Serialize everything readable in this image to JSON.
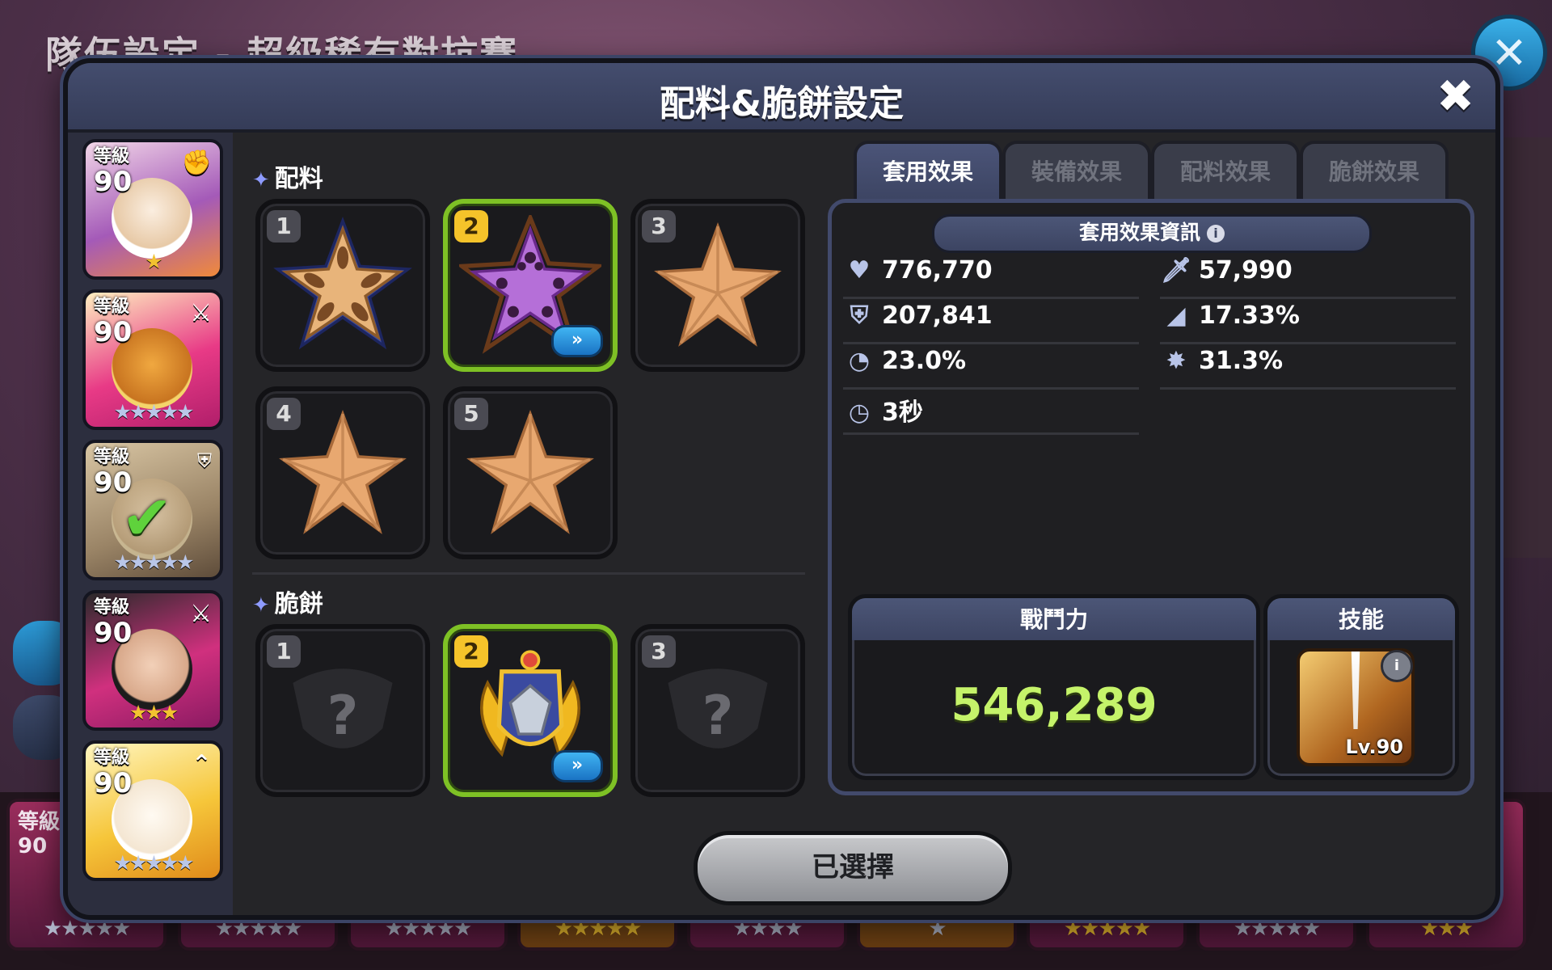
{
  "background": {
    "title": "隊伍設定 - 超級稀有對抗賽",
    "level_label": "等級",
    "level_value": "90"
  },
  "dialog": {
    "title": "配料&脆餅設定",
    "close_label": "✖"
  },
  "roster": [
    {
      "level_label": "等級",
      "level": "90",
      "stars": "★",
      "star_color": "#f2c230",
      "class_icon": "✊",
      "selected": false
    },
    {
      "level_label": "等級",
      "level": "90",
      "stars": "★★★★★",
      "star_color": "#b9c6e8",
      "class_icon": "⚔",
      "selected": false
    },
    {
      "level_label": "等級",
      "level": "90",
      "stars": "★★★★★",
      "star_color": "#b9c6e8",
      "class_icon": "⛨",
      "selected": true
    },
    {
      "level_label": "等級",
      "level": "90",
      "stars": "★★★",
      "star_color": "#f2c230",
      "class_icon": "⚔",
      "selected": false
    },
    {
      "level_label": "等級",
      "level": "90",
      "stars": "★★★★★",
      "star_color": "#b9c6e8",
      "class_icon": "⌃",
      "selected": false
    }
  ],
  "toppings": {
    "label": "配料",
    "slots": [
      {
        "num": "1",
        "type": "filled-almond"
      },
      {
        "num": "2",
        "type": "filled-purple",
        "selected": true,
        "upgrade": "»"
      },
      {
        "num": "3",
        "type": "empty"
      },
      {
        "num": "4",
        "type": "empty"
      },
      {
        "num": "5",
        "type": "empty"
      }
    ]
  },
  "tarts": {
    "label": "脆餅",
    "slots": [
      {
        "num": "1",
        "type": "unknown",
        "placeholder": "?"
      },
      {
        "num": "2",
        "type": "crest",
        "selected": true,
        "upgrade": "»"
      },
      {
        "num": "3",
        "type": "unknown",
        "placeholder": "?"
      }
    ]
  },
  "tabs": [
    {
      "label": "套用效果",
      "active": true
    },
    {
      "label": "裝備效果",
      "active": false
    },
    {
      "label": "配料效果",
      "active": false
    },
    {
      "label": "脆餅效果",
      "active": false
    }
  ],
  "stats_panel": {
    "title": "套用效果資訊",
    "info_icon": "i",
    "stats": [
      {
        "icon": "heart-icon",
        "glyph": "♥",
        "value": "776,770"
      },
      {
        "icon": "sword-icon",
        "glyph": "🗡",
        "value": "57,990"
      },
      {
        "icon": "shield-icon",
        "glyph": "⛨",
        "value": "207,841"
      },
      {
        "icon": "crit-icon",
        "glyph": "◢",
        "value": "17.33%"
      },
      {
        "icon": "cooldown-icon",
        "glyph": "◔",
        "value": "23.0%"
      },
      {
        "icon": "burst-icon",
        "glyph": "✸",
        "value": "31.3%"
      },
      {
        "icon": "timer-icon",
        "glyph": "◷",
        "value": "3秒"
      }
    ]
  },
  "power": {
    "label": "戰鬥力",
    "value": "546,289"
  },
  "skill": {
    "label": "技能",
    "level": "Lv.90",
    "info_icon": "i"
  },
  "confirm_button": "已選擇",
  "colors": {
    "accent_green": "#7ec125",
    "power_green": "#c5f36a",
    "header_blue": "#3c4462",
    "badge_yellow": "#f5c32a"
  }
}
